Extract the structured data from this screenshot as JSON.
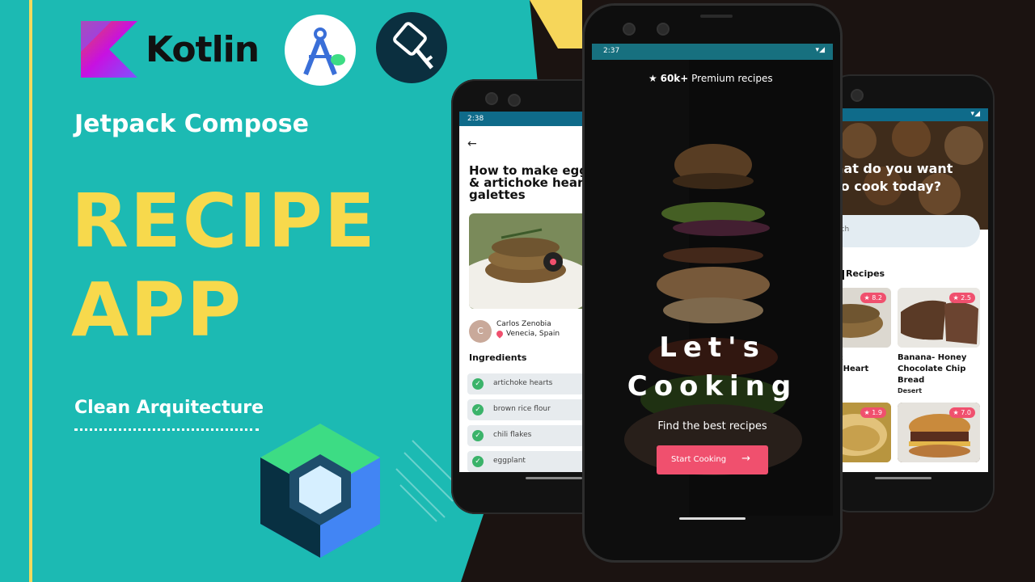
{
  "brand": {
    "kotlin_word": "Kotlin"
  },
  "hero": {
    "subtitle": "Jetpack Compose",
    "title_line1": "RECIPE",
    "title_line2": "APP",
    "tagline": "Clean Arquitecture"
  },
  "colors": {
    "teal_bg": "#1cbab3",
    "dark_bg": "#1b1311",
    "accent_yellow": "#f7d94c",
    "cta_red": "#f0506e",
    "status_bar": "#0f6b8a"
  },
  "phone_left": {
    "status_time": "2:38",
    "recipe_title_line1": "How to make egg",
    "recipe_title_line2": "& artichoke hear",
    "recipe_title_line3": "galettes",
    "author_initial": "C",
    "author_name": "Carlos Zenobia",
    "author_location": "Venecia, Spain",
    "ingredients_title": "Ingredients",
    "ingredients": [
      "artichoke hearts",
      "brown rice flour",
      "chili flakes",
      "eggplant"
    ]
  },
  "phone_center": {
    "status_time": "2:37",
    "premium_count": "60k+",
    "premium_label": "Premium recipes",
    "headline_line1": "Let's",
    "headline_line2": "Cooking",
    "subtext": "Find the best recipes",
    "cta_label": "Start Cooking"
  },
  "phone_right": {
    "greeting_line1": "hat do you want",
    "greeting_line2": "to cook today?",
    "search_placeholder": "rch",
    "section_title": "Recipes",
    "cards": [
      {
        "rating": "8.2",
        "title_line1": "t &",
        "title_line2": "ke Heart",
        "title_line3": "s",
        "category": ""
      },
      {
        "rating": "2.5",
        "title_line1": "Banana- Honey",
        "title_line2": "Chocolate Chip",
        "title_line3": "Bread",
        "category": "Desert"
      },
      {
        "rating": "1.9",
        "title_line1": "",
        "title_line2": "",
        "title_line3": "",
        "category": ""
      },
      {
        "rating": "7.0",
        "title_line1": "",
        "title_line2": "",
        "title_line3": "",
        "category": ""
      }
    ]
  }
}
